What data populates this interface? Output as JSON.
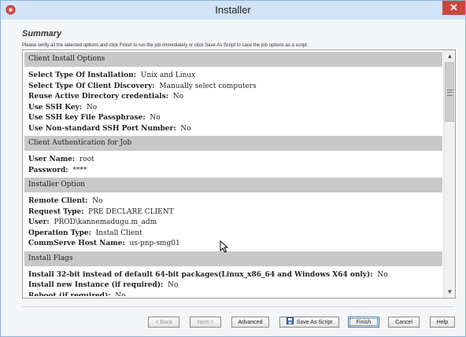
{
  "window": {
    "title": "Installer",
    "close_glyph": "✕"
  },
  "summary": {
    "title": "Summary",
    "description": "Please verify all the selected options and click Finish to run the job immediately or click Save As Script to save the job options as a script."
  },
  "sections": [
    {
      "header": "Client Install Options",
      "rows": [
        {
          "key": "Select Type Of Installation:",
          "value": "Unix and Linux"
        },
        {
          "key": "Select Type Of Client Discovery:",
          "value": "Manually select computers"
        },
        {
          "key": "Reuse Active Directory credentials:",
          "value": "No"
        },
        {
          "key": "Use SSH Key:",
          "value": "No"
        },
        {
          "key": "Use SSH key File Passphrase:",
          "value": "No"
        },
        {
          "key": "Use Non-standard SSH Port Number:",
          "value": "No"
        }
      ]
    },
    {
      "header": "Client Authentication for Job",
      "rows": [
        {
          "key": "User Name:",
          "value": "root"
        },
        {
          "key": "Password:",
          "value": "****"
        }
      ]
    },
    {
      "header": "Installer Option",
      "rows": [
        {
          "key": "Remote Client:",
          "value": "No"
        },
        {
          "key": "Request Type:",
          "value": "PRE DECLARE CLIENT"
        },
        {
          "key": "User:",
          "value": "PROD\\kannemadugu.m_adm"
        },
        {
          "key": "Operation Type:",
          "value": "Install Client"
        },
        {
          "key": "CommServe Host Name:",
          "value": "us-pnp-smg01"
        }
      ]
    },
    {
      "header": "Install Flags",
      "rows": [
        {
          "key": "Install 32-bit instead of default 64-bit packages(Linux_x86_64 and Windows X64 only):",
          "value": "No"
        },
        {
          "key": "Install new Instance (if required):",
          "value": "No"
        },
        {
          "key": "Reboot (if required):",
          "value": "No"
        }
      ]
    }
  ],
  "buttons": {
    "back": "< Back",
    "next": "Next >",
    "advanced": "Advanced",
    "save_as_script": "Save As Script",
    "finish": "Finish",
    "cancel": "Cancel",
    "help": "Help"
  },
  "colors": {
    "titlebar": "#d1e3f6",
    "close": "#c9483d",
    "section_header": "#c8c8c8"
  }
}
